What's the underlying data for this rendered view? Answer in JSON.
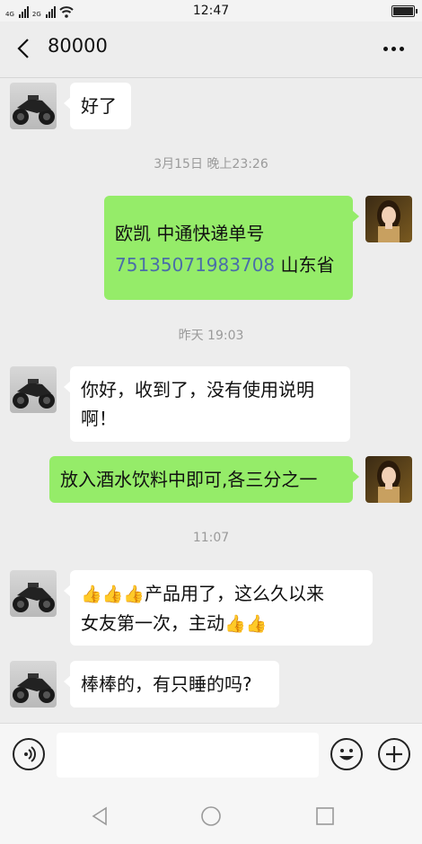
{
  "status_bar": {
    "time": "12:47",
    "net_4g": "4G",
    "net_2g": "2G"
  },
  "header": {
    "title": "80000"
  },
  "messages": {
    "m1": {
      "text": "好了"
    },
    "ts1": "3月15日 晚上23:26",
    "m2": {
      "line1": "欧凯 中通快递单号",
      "tracking": "75135071983708",
      "line2_suffix": " 山东省"
    },
    "ts2": "昨天 19:03",
    "m3": {
      "line1": "你好，收到了，没有使用说明",
      "line2": "啊！"
    },
    "m4": {
      "text": "放入酒水饮料中即可,各三分之一"
    },
    "ts3": "11:07",
    "m5": {
      "thumbs": "👍👍👍",
      "line1": "产品用了，这么久以来",
      "line2": "女友第一次，主动",
      "thumbs2": "👍👍"
    },
    "m6": {
      "text": "棒棒的，有只睡的吗?"
    }
  },
  "icons": {
    "back": "back-arrow-icon",
    "more": "more-icon",
    "voice": "voice-icon",
    "emoji": "emoji-icon",
    "plus": "plus-icon"
  },
  "colors": {
    "outgoing_bubble": "#95ec69",
    "incoming_bubble": "#ffffff",
    "background": "#ededed",
    "link": "#4a6ea8"
  }
}
